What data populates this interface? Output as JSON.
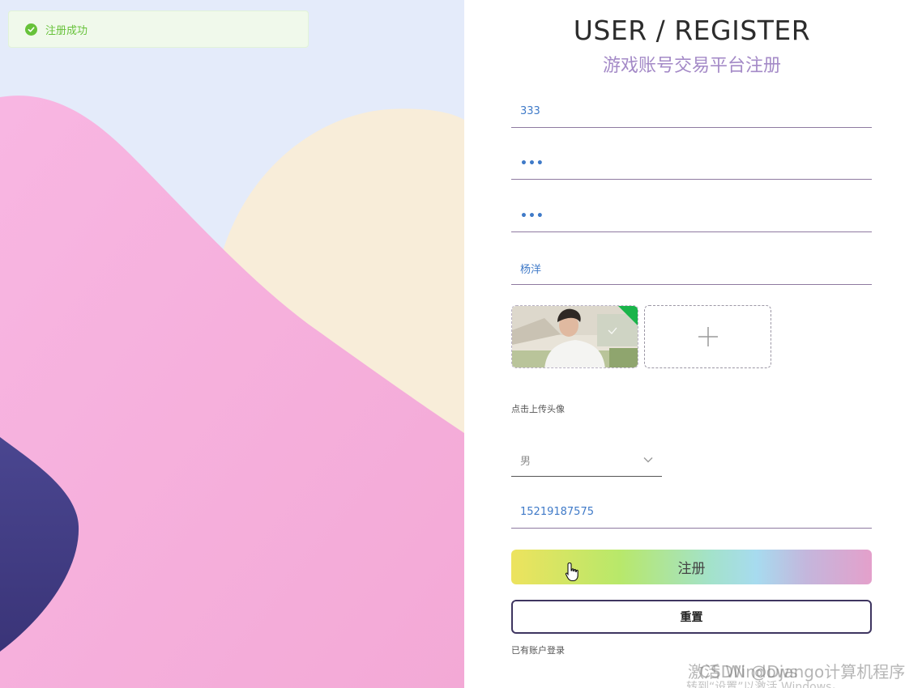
{
  "toast": {
    "message": "注册成功",
    "icon": "check-circle-icon",
    "color": "#67c23a"
  },
  "header": {
    "title": "USER / REGISTER",
    "subtitle": "游戏账号交易平台注册"
  },
  "form": {
    "username": "333",
    "password_mask": "•••",
    "confirm_password_mask": "•••",
    "name": "杨洋",
    "avatar_hint": "点击上传头像",
    "gender": "男",
    "phone": "15219187575",
    "register_label": "注册",
    "reset_label": "重置",
    "login_link": "已有账户登录"
  },
  "watermark": {
    "line1": "激活 Windows",
    "line2": "转到“设置”以激活 Windows。",
    "csdn": "CSDN @Django计算机程序"
  },
  "colors": {
    "accent_purple": "#a48ac7",
    "input_text": "#3f7ac8",
    "success": "#67c23a",
    "reset_border": "#3e3560"
  }
}
